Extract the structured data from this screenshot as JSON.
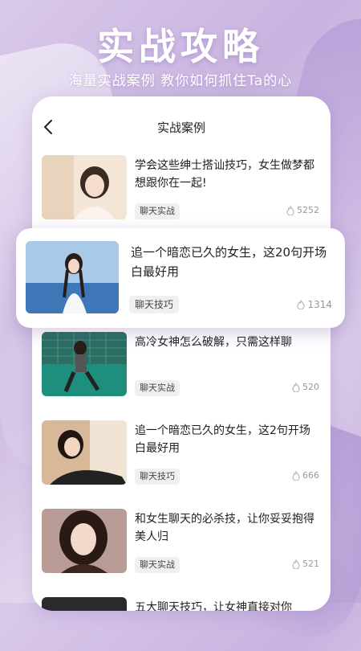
{
  "hero": {
    "title": "实战攻略",
    "subtitle": "海量实战案例 教你如何抓住Ta的心"
  },
  "screen": {
    "title": "实战案例"
  },
  "articles": [
    {
      "title": "学会这些绅士搭讪技巧，女生做梦都想跟你在一起!",
      "tag": "聊天实战",
      "likes": "5252"
    },
    {
      "title": "追一个暗恋已久的女生，这20句开场白最好用",
      "tag": "聊天技巧",
      "likes": "1314",
      "featured": true
    },
    {
      "title": "高冷女神怎么破解，只需这样聊",
      "tag": "聊天实战",
      "likes": "520"
    },
    {
      "title": "追一个暗恋已久的女生，这2句开场白最好用",
      "tag": "聊天技巧",
      "likes": "666"
    },
    {
      "title": "和女生聊天的必杀技，让你妥妥抱得美人归",
      "tag": "聊天实战",
      "likes": "521"
    },
    {
      "title": "五大聊天技巧，让女神直接对你",
      "tag": "",
      "likes": ""
    }
  ],
  "icons": {
    "back": "chevron-left-icon",
    "likes": "flame-icon"
  },
  "colors": {
    "background": "#d3c1e6",
    "card": "#ffffff",
    "tag_bg": "#f0f0f2",
    "muted": "#999999"
  }
}
